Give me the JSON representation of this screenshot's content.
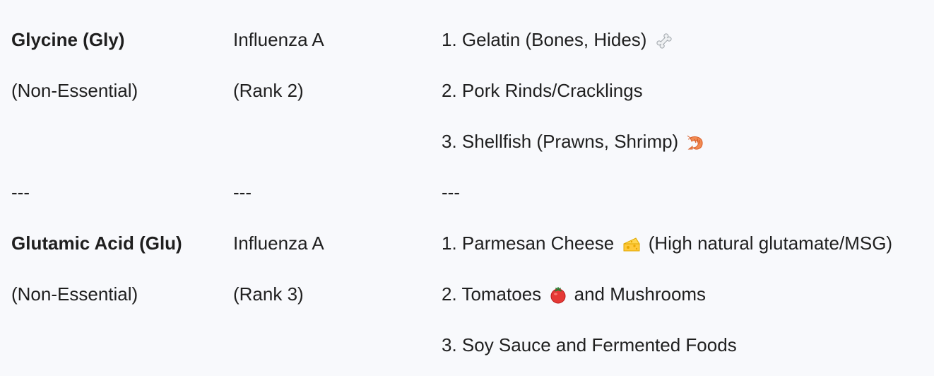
{
  "sections": [
    {
      "amino_acid": "Glycine (Gly)",
      "category": "(Non-Essential)",
      "virus": "Influenza A",
      "rank": "(Rank 2)",
      "foods": [
        {
          "text": "1. Gelatin (Bones, Hides)",
          "icon": "bone-icon",
          "suffix": ""
        },
        {
          "text": "2. Pork Rinds/Cracklings",
          "icon": "",
          "suffix": ""
        },
        {
          "text": "3. Shellfish (Prawns, Shrimp)",
          "icon": "shrimp-icon",
          "suffix": ""
        }
      ]
    },
    {
      "amino_acid": "Glutamic Acid (Glu)",
      "category": "(Non-Essential)",
      "virus": "Influenza A",
      "rank": "(Rank 3)",
      "foods": [
        {
          "text": "1. Parmesan Cheese",
          "icon": "cheese-icon",
          "suffix": "(High natural glutamate/MSG)"
        },
        {
          "text": "2. Tomatoes",
          "icon": "tomato-icon",
          "suffix": "and Mushrooms"
        },
        {
          "text": "3. Soy Sauce and Fermented Foods",
          "icon": "",
          "suffix": ""
        }
      ]
    }
  ],
  "separator": "---"
}
